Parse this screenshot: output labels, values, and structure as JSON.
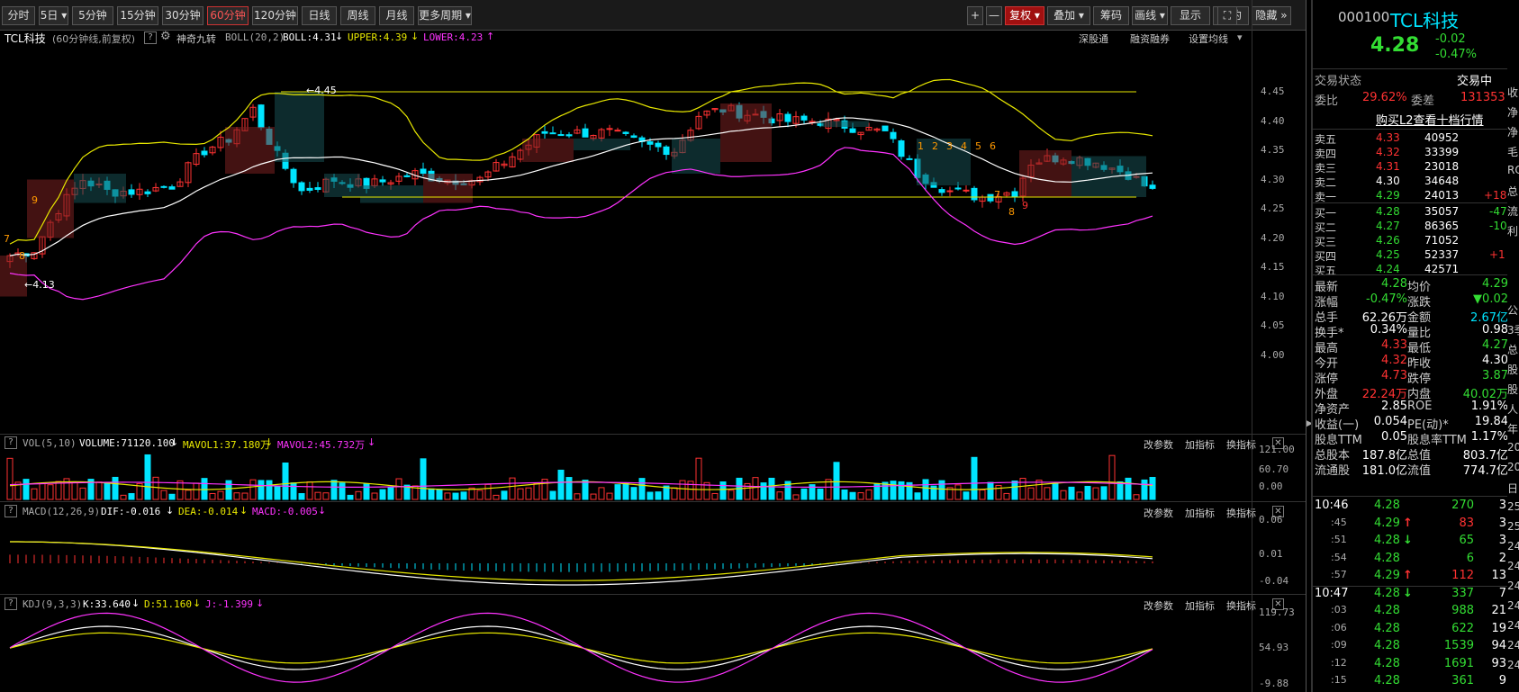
{
  "toolbar": {
    "periods": [
      "分时",
      "5日",
      "5分钟",
      "15分钟",
      "30分钟",
      "60分钟",
      "120分钟",
      "日线",
      "周线",
      "月线",
      "更多周期"
    ],
    "active_period": "60分钟",
    "right_buttons": [
      "+",
      "—",
      "复权",
      "叠加",
      "筹码",
      "画线",
      "显示",
      "简约",
      "隐藏"
    ]
  },
  "main_chart": {
    "stock_name": "TCL科技",
    "chart_desc": "(60分钟线,前复权)",
    "indicator_tag": "神奇九转",
    "boll_label": "BOLL(20,2)",
    "boll_value": "BOLL:4.31",
    "upper_value": "UPPER:4.39",
    "lower_value": "LOWER:4.23",
    "links": [
      "深股通",
      "融资融券",
      "设置均线"
    ],
    "high_label": "4.45",
    "low_label": "4.13",
    "y_ticks": [
      "4.45",
      "4.40",
      "4.35",
      "4.30",
      "4.25",
      "4.20",
      "4.15",
      "4.10",
      "4.05",
      "4.00"
    ],
    "nine_labels_upper": [
      "1",
      "2",
      "3",
      "4",
      "5",
      "6"
    ],
    "count_labels": {
      "a": "7",
      "b": "8",
      "c": "9",
      "d": "7",
      "e": "8",
      "f": "9"
    }
  },
  "vol_panel": {
    "title": "VOL(5,10)",
    "volume": "VOLUME:71120.100",
    "mavol1": "MAVOL1:37.180万",
    "mavol2": "MAVOL2:45.732万",
    "links": [
      "改参数",
      "加指标",
      "换指标"
    ],
    "y_ticks": [
      "121.00",
      "60.70",
      "0.00"
    ]
  },
  "macd_panel": {
    "title": "MACD(12,26,9)",
    "dif": "DIF:-0.016",
    "dea": "DEA:-0.014",
    "macd": "MACD:-0.005",
    "links": [
      "改参数",
      "加指标",
      "换指标"
    ],
    "y_ticks": [
      "0.06",
      "0.01",
      "-0.04"
    ]
  },
  "kdj_panel": {
    "title": "KDJ(9,3,3)",
    "k": "K:33.640",
    "d": "D:51.160",
    "j": "J:-1.399",
    "links": [
      "改参数",
      "加指标",
      "换指标"
    ],
    "y_ticks": [
      "119.73",
      "54.93",
      "-9.88"
    ]
  },
  "right_panel": {
    "code": "000100",
    "name": "TCL科技",
    "price": "4.28",
    "change": "-0.02",
    "change_pct": "-0.47%",
    "trade_status_label": "交易状态",
    "trade_status": "交易中",
    "weibi_label": "委比",
    "weibi": "29.62%",
    "weicha_label": "委差",
    "weicha": "131353",
    "l2_link": "购买L2查看十档行情",
    "sells": [
      {
        "label": "卖五",
        "price": "4.33",
        "vol": "40952",
        "chg": ""
      },
      {
        "label": "卖四",
        "price": "4.32",
        "vol": "33399",
        "chg": ""
      },
      {
        "label": "卖三",
        "price": "4.31",
        "vol": "23018",
        "chg": ""
      },
      {
        "label": "卖二",
        "price": "4.30",
        "vol": "34648",
        "chg": ""
      },
      {
        "label": "卖一",
        "price": "4.29",
        "vol": "24013",
        "chg": "+182"
      }
    ],
    "buys": [
      {
        "label": "买一",
        "price": "4.28",
        "vol": "35057",
        "chg": "-47"
      },
      {
        "label": "买二",
        "price": "4.27",
        "vol": "86365",
        "chg": "-10"
      },
      {
        "label": "买三",
        "price": "4.26",
        "vol": "71052",
        "chg": ""
      },
      {
        "label": "买四",
        "price": "4.25",
        "vol": "52337",
        "chg": "+1"
      },
      {
        "label": "买五",
        "price": "4.24",
        "vol": "42571",
        "chg": ""
      }
    ],
    "stats": [
      {
        "l1": "最新",
        "v1": "4.28",
        "l2": "均价",
        "v2": "4.29"
      },
      {
        "l1": "涨幅",
        "v1": "-0.47%",
        "l2": "涨跌",
        "v2": "▼0.02"
      },
      {
        "l1": "总手",
        "v1": "62.26万",
        "l2": "金额",
        "v2": "2.67亿"
      },
      {
        "l1": "换手*",
        "v1": "0.34%",
        "l2": "量比",
        "v2": "0.98"
      },
      {
        "l1": "最高",
        "v1": "4.33",
        "l2": "最低",
        "v2": "4.27"
      },
      {
        "l1": "今开",
        "v1": "4.32",
        "l2": "昨收",
        "v2": "4.30"
      },
      {
        "l1": "涨停",
        "v1": "4.73",
        "l2": "跌停",
        "v2": "3.87"
      },
      {
        "l1": "外盘",
        "v1": "22.24万",
        "l2": "内盘",
        "v2": "40.02万"
      },
      {
        "l1": "净资产",
        "v1": "2.85",
        "l2": "ROE",
        "v2": "1.91%"
      },
      {
        "l1": "收益(一)",
        "v1": "0.054",
        "l2": "PE(动)*",
        "v2": "19.84"
      },
      {
        "l1": "股息TTM",
        "v1": "0.05",
        "l2": "股息率TTM",
        "v2": "1.17%"
      },
      {
        "l1": "总股本",
        "v1": "187.8亿",
        "l2": "总值",
        "v2": "803.7亿"
      },
      {
        "l1": "流通股",
        "v1": "181.0亿",
        "l2": "流值",
        "v2": "774.7亿"
      }
    ],
    "ticks": [
      {
        "time": "10:46",
        "price": "4.28",
        "arrow": "",
        "vol": "270",
        "n": "3"
      },
      {
        "time": ":45",
        "price": "4.29",
        "arrow": "↑",
        "vol": "83",
        "n": "3"
      },
      {
        "time": ":51",
        "price": "4.28",
        "arrow": "↓",
        "vol": "65",
        "n": "3"
      },
      {
        "time": ":54",
        "price": "4.28",
        "arrow": "",
        "vol": "6",
        "n": "2"
      },
      {
        "time": ":57",
        "price": "4.29",
        "arrow": "↑",
        "vol": "112",
        "n": "13"
      },
      {
        "time": "10:47",
        "price": "4.28",
        "arrow": "↓",
        "vol": "337",
        "n": "7"
      },
      {
        "time": ":03",
        "price": "4.28",
        "arrow": "",
        "vol": "988",
        "n": "21"
      },
      {
        "time": ":06",
        "price": "4.28",
        "arrow": "",
        "vol": "622",
        "n": "19"
      },
      {
        "time": ":09",
        "price": "4.28",
        "arrow": "",
        "vol": "1539",
        "n": "94"
      },
      {
        "time": ":12",
        "price": "4.28",
        "arrow": "",
        "vol": "1691",
        "n": "93"
      },
      {
        "time": ":15",
        "price": "4.28",
        "arrow": "",
        "vol": "361",
        "n": "9"
      }
    ],
    "edge_chars": [
      "收",
      "净",
      "净",
      "毛",
      "RO",
      "总",
      "流",
      "利",
      "",
      "",
      "",
      "公",
      "3季",
      "总",
      "股",
      "股",
      "人",
      "年",
      "20",
      "20",
      "日",
      "25",
      "25",
      "24",
      "24",
      "24",
      "24",
      "24",
      "24",
      "24"
    ]
  },
  "colors": {
    "up": "#ff3232",
    "down": "#00e5ff",
    "yellow": "#e8e800",
    "magenta": "#ff33ff",
    "white": "#ffffff",
    "green": "#33dd33",
    "orange": "#ff9900"
  }
}
